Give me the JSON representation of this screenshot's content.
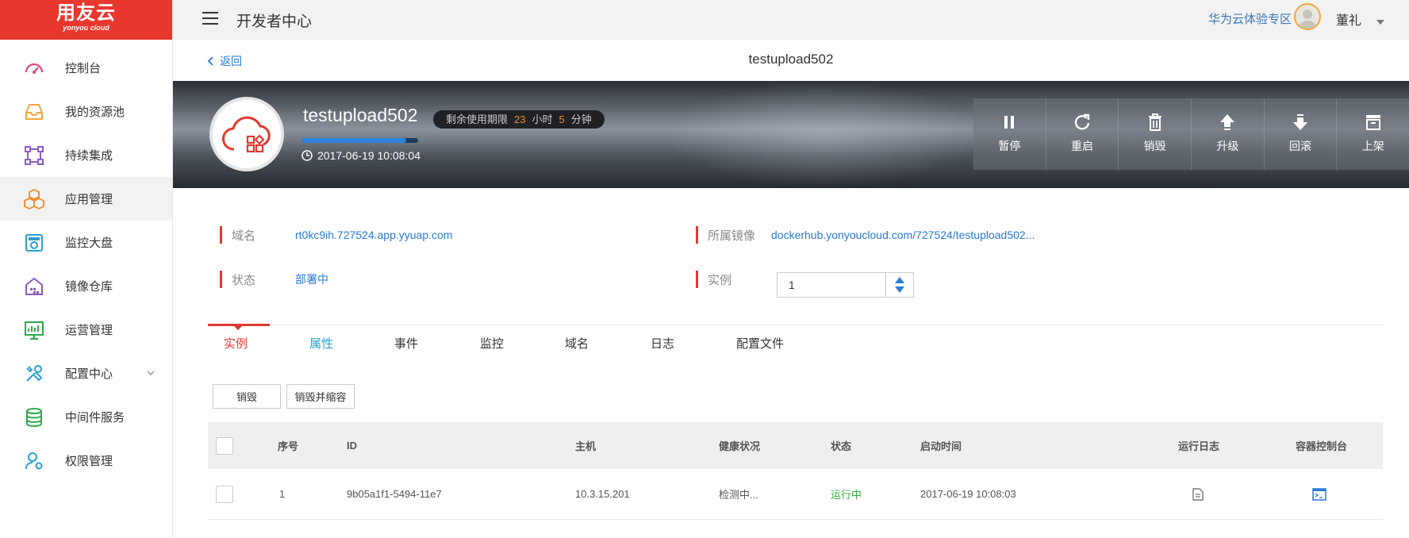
{
  "brand": {
    "name": "用友云",
    "sub": "yonyou cloud"
  },
  "colors": {
    "brand": "#e8372f",
    "accent": "#2a7ad5",
    "warn": "#f08a24",
    "success": "#3daf3d"
  },
  "sidebar": {
    "items": [
      {
        "label": "控制台",
        "icon": "dashboard-gauge-icon"
      },
      {
        "label": "我的资源池",
        "icon": "inbox-tray-icon"
      },
      {
        "label": "持续集成",
        "icon": "integration-square-icon"
      },
      {
        "label": "应用管理",
        "icon": "cubes-icon",
        "active": true
      },
      {
        "label": "监控大盘",
        "icon": "monitor-screen-icon"
      },
      {
        "label": "镜像仓库",
        "icon": "warehouse-icon"
      },
      {
        "label": "运营管理",
        "icon": "chart-board-icon"
      },
      {
        "label": "配置中心",
        "icon": "tools-icon",
        "expandable": true
      },
      {
        "label": "中间件服务",
        "icon": "database-icon"
      },
      {
        "label": "权限管理",
        "icon": "user-gear-icon"
      }
    ]
  },
  "header": {
    "title": "开发者中心",
    "region": "华为云体验专区",
    "user": "董礼"
  },
  "back": {
    "label": "返回"
  },
  "page": {
    "title": "testupload502"
  },
  "app": {
    "name": "testupload502",
    "expire_prefix": "剩余使用期限",
    "expire_hours": "23",
    "hours_unit": "小时",
    "expire_minutes": "5",
    "minutes_unit": "分钟",
    "progress_fraction": 0.9,
    "created": "2017-06-19 10:08:04"
  },
  "actions": [
    {
      "label": "暂停",
      "icon": "pause-icon"
    },
    {
      "label": "重启",
      "icon": "restart-icon"
    },
    {
      "label": "销毁",
      "icon": "trash-icon"
    },
    {
      "label": "升级",
      "icon": "arrow-up-icon"
    },
    {
      "label": "回滚",
      "icon": "arrow-down-icon"
    },
    {
      "label": "上架",
      "icon": "shelf-icon"
    }
  ],
  "info": {
    "domain_label": "域名",
    "domain_value": "rt0kc9ih.727524.app.yyuap.com",
    "image_label": "所属镜像",
    "image_value": "dockerhub.yonyoucloud.com/727524/testupload502...",
    "status_label": "状态",
    "status_value": "部署中",
    "instance_label": "实例",
    "instance_value": "1"
  },
  "tabs": [
    "实例",
    "属性",
    "事件",
    "监控",
    "域名",
    "日志",
    "配置文件"
  ],
  "buttons": {
    "destroy": "销毁",
    "destroy_scale": "销毁并缩容"
  },
  "table": {
    "columns": [
      "序号",
      "ID",
      "主机",
      "健康状况",
      "状态",
      "启动时间",
      "运行日志",
      "容器控制台"
    ],
    "rows": [
      {
        "index": "1",
        "id": "9b05a1f1-5494-11e7",
        "host": "10.3.15.201",
        "health": "检测中...",
        "status": "运行中",
        "started": "2017-06-19 10:08:03"
      }
    ]
  }
}
